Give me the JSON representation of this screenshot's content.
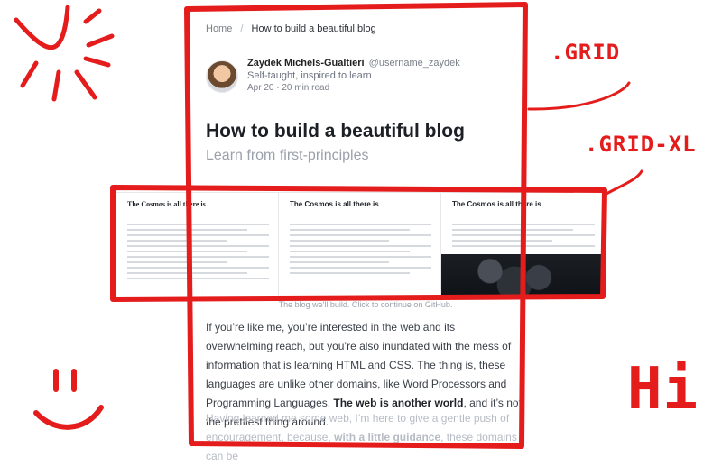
{
  "breadcrumb": {
    "home": "Home",
    "separator": "/",
    "current": "How to build a beautiful blog"
  },
  "author": {
    "name": "Zaydek Michels-Gualtieri",
    "handle": "@username_zaydek",
    "tagline": "Self-taught, inspired to learn",
    "meta": "Apr 20 · 20 min read"
  },
  "post": {
    "title": "How to build a beautiful blog",
    "subtitle": "Learn from first-principles"
  },
  "preview": {
    "panels": [
      {
        "title": "The Cosmos is all there is"
      },
      {
        "title": "The Cosmos is all there is"
      },
      {
        "title": "The Cosmos is all there is"
      }
    ],
    "caption": "The blog we'll build. Click to continue on GitHub."
  },
  "body": {
    "p1_a": "If you’re like me, you’re interested in the web and its overwhelming reach, but you’re also inundated with the mess of information that is learning HTML and CSS. The thing is, these languages are unlike other domains, like Word Processors and Programming Languages. ",
    "p1_strong": "The web is another world",
    "p1_b": ", and it’s not the prettiest thing around.",
    "p2_a": "Having learned me some web, I’m here to give a gentle push of encouragement, because, ",
    "p2_strong": "with a little guidance",
    "p2_b": ", these domains can be"
  },
  "annotations": {
    "grid": ".GRID",
    "grid_xl": ".GRID-XL",
    "hi": "Hi"
  },
  "colors": {
    "annotation_red": "#e41c1c",
    "text_dark": "#1c1f24",
    "text_muted": "#7a7f87"
  }
}
